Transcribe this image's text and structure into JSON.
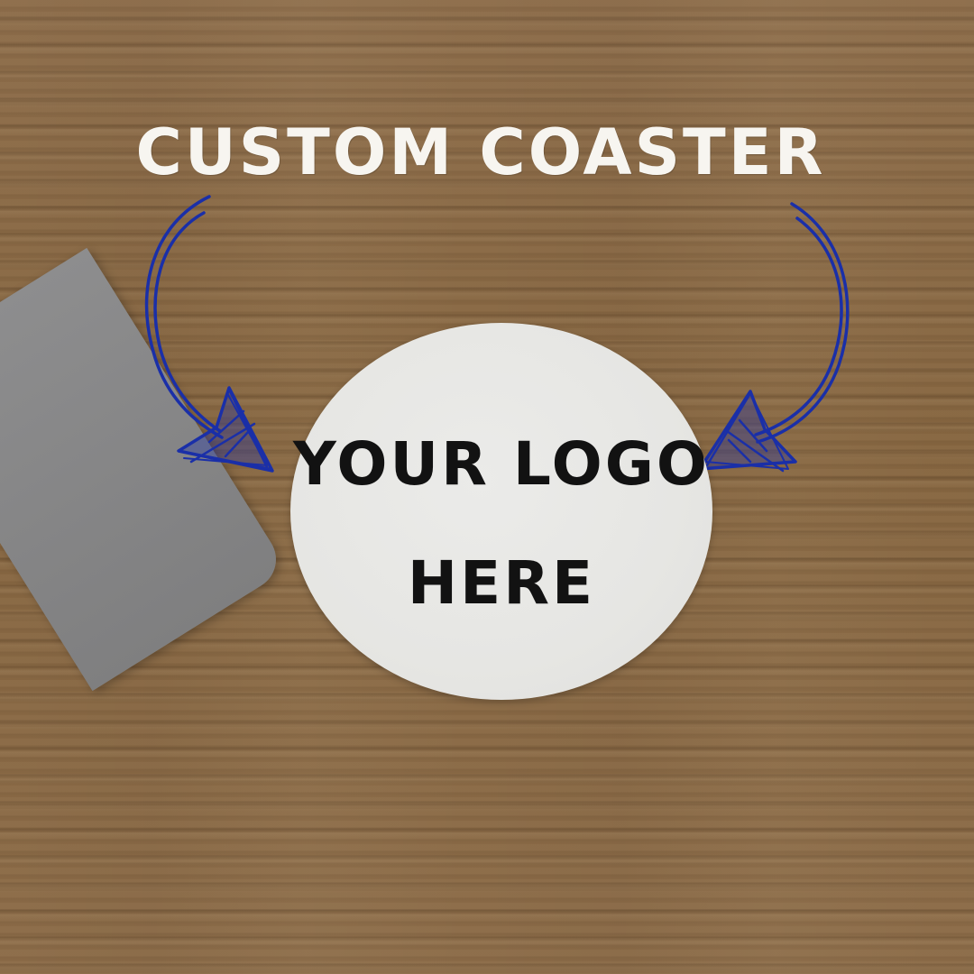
{
  "headline": "CUSTOM COASTER",
  "coaster": {
    "line1": "YOUR LOGO",
    "line2": "HERE"
  },
  "colors": {
    "wood": "#8a6a48",
    "headline_text": "#f7f5f0",
    "arrow": "#1a2fa8",
    "coaster": "#e6e6e3",
    "coaster_text": "#121212",
    "laptop": "#8d8d8e"
  },
  "icons": [
    "left-curved-arrow-icon",
    "right-curved-arrow-icon"
  ]
}
